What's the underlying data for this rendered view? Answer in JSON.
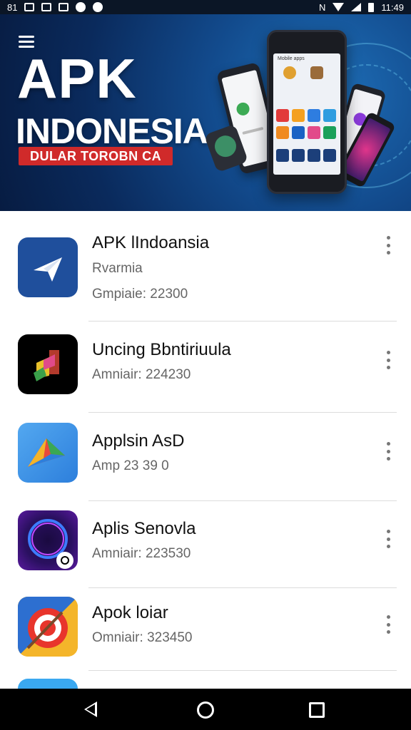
{
  "status_bar": {
    "left_text": "81",
    "time": "11:49"
  },
  "banner": {
    "title_line1": "APK",
    "title_line2": "INDONESIA",
    "tagline": "DULAR TOROBN CA",
    "phone_header": "Mobile apps"
  },
  "apps": [
    {
      "name": "APK lIndoansia",
      "line1": "Rvarmia",
      "line2": "Gmpiaie: 22300",
      "icon": "paper-plane-icon",
      "color": "#1f4f9c"
    },
    {
      "name": "Uncing Bbntiriuula",
      "line1": "Amniair: 224230",
      "icon": "colorful-cube-icon",
      "color": "#000000"
    },
    {
      "name": "Applsin AsD",
      "line1": "Amp 23 39 0",
      "icon": "google-play-icon",
      "color": "#3d8ee6"
    },
    {
      "name": "Aplis Senovla",
      "line1": "Amniair: 223530",
      "icon": "glowing-ring-icon",
      "color": "#2a1060"
    },
    {
      "name": "Apok loiar",
      "line1": "Omniair: 323450",
      "icon": "target-icon",
      "color": "#f4b52a"
    }
  ],
  "accent": "#1f4f9c"
}
